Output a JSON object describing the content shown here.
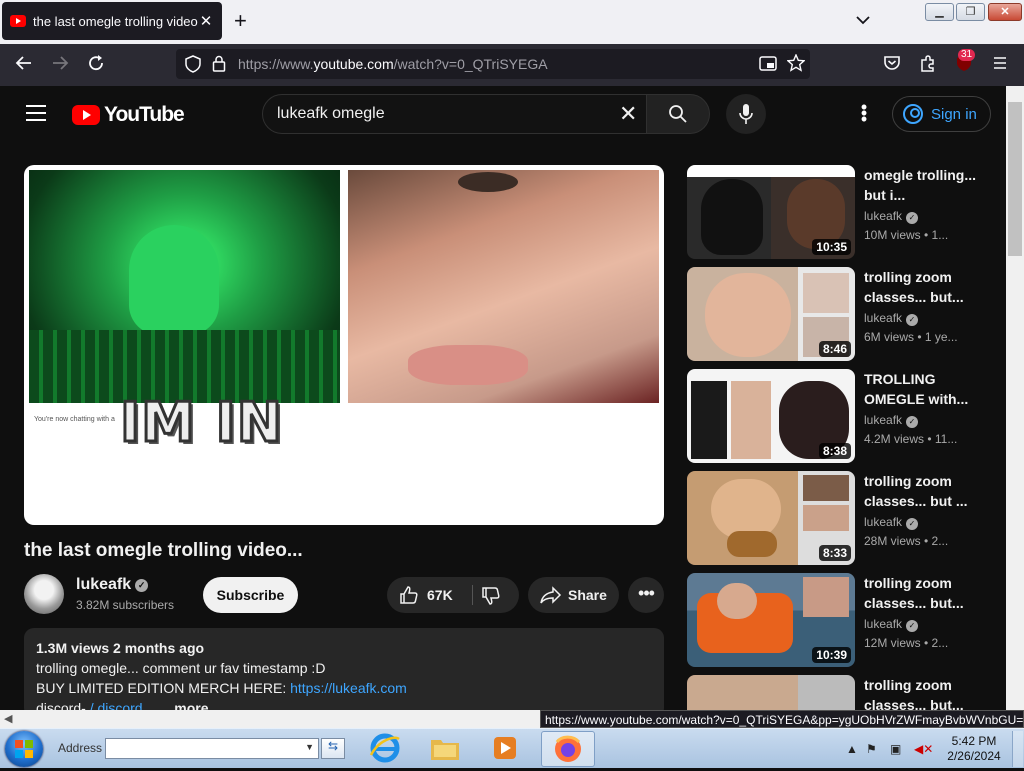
{
  "browser": {
    "tab_title": "the last omegle trolling video...",
    "url_prefix": "https://www.",
    "url_host": "youtube.com",
    "url_path": "/watch?v=0_QTriSYEGA",
    "extension_badge": "31",
    "status_url": "https://www.youtube.com/watch?v=0_QTriSYEGA&pp=ygUObHVrZWFmayBvbWVnbGU="
  },
  "youtube": {
    "logo_text": "YouTube",
    "search_query": "lukeafk omegle",
    "sign_in": "Sign in"
  },
  "player": {
    "overlay_text": "IM IN",
    "chat_text": "You're now chatting with a"
  },
  "video": {
    "title": "the last omegle trolling video...",
    "channel": "lukeafk",
    "subscribers": "3.82M subscribers",
    "subscribe_label": "Subscribe",
    "likes": "67K",
    "share_label": "Share",
    "description": {
      "stats": "1.3M views  2 months ago",
      "line1": "trolling omegle... comment ur fav timestamp :D",
      "line2_prefix": "BUY LIMITED EDITION MERCH HERE: ",
      "line2_link": "https://lukeafk.com",
      "line3_prefix": "discord- ",
      "line3_link": "/ discord",
      "more": "...more"
    }
  },
  "sidebar": [
    {
      "title": "omegle trolling... but i...",
      "channel": "lukeafk",
      "meta": "10M views  • 1...",
      "duration": "10:35"
    },
    {
      "title": "trolling zoom classes... but...",
      "channel": "lukeafk",
      "meta": "6M views  • 1 ye...",
      "duration": "8:46"
    },
    {
      "title": "TROLLING OMEGLE with...",
      "channel": "lukeafk",
      "meta": "4.2M views  • 11...",
      "duration": "8:38"
    },
    {
      "title": "trolling zoom classes... but ...",
      "channel": "lukeafk",
      "meta": "28M views  • 2...",
      "duration": "8:33"
    },
    {
      "title": "trolling zoom classes... but...",
      "channel": "lukeafk",
      "meta": "12M views  • 2...",
      "duration": "10:39"
    },
    {
      "title": "trolling zoom classes... but..."
    }
  ],
  "taskbar": {
    "address_label": "Address",
    "time": "5:42 PM",
    "date": "2/26/2024"
  },
  "colors": {
    "youtube_red": "#ff0000",
    "link_blue": "#3ea6ff",
    "page_bg": "#0f0f0f"
  }
}
